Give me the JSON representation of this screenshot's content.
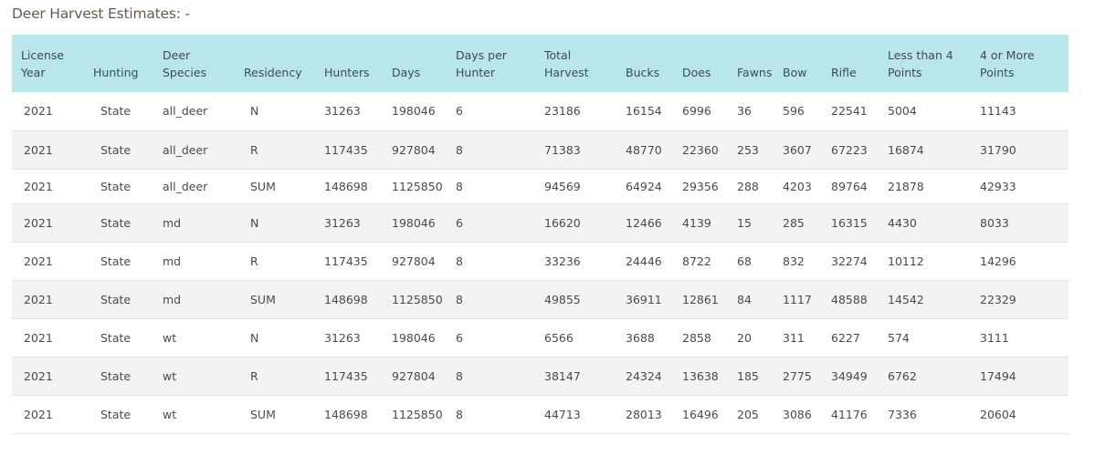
{
  "page": {
    "title": "Deer Harvest Estimates: -"
  },
  "table": {
    "columns": [
      {
        "key": "year",
        "label_lines": [
          "License",
          "Year"
        ]
      },
      {
        "key": "hunting",
        "label_lines": [
          "",
          "Hunting"
        ]
      },
      {
        "key": "species",
        "label_lines": [
          "Deer",
          "Species"
        ]
      },
      {
        "key": "residency",
        "label_lines": [
          "",
          "Residency"
        ]
      },
      {
        "key": "hunters",
        "label_lines": [
          "",
          "Hunters"
        ]
      },
      {
        "key": "days",
        "label_lines": [
          "",
          "Days"
        ]
      },
      {
        "key": "days_per_hunter",
        "label_lines": [
          "Days per",
          "Hunter"
        ]
      },
      {
        "key": "total_harvest",
        "label_lines": [
          "Total",
          "Harvest"
        ]
      },
      {
        "key": "bucks",
        "label_lines": [
          "",
          "Bucks"
        ]
      },
      {
        "key": "does",
        "label_lines": [
          "",
          "Does"
        ]
      },
      {
        "key": "fawns",
        "label_lines": [
          "",
          "Fawns"
        ]
      },
      {
        "key": "bow",
        "label_lines": [
          "",
          "Bow"
        ]
      },
      {
        "key": "rifle",
        "label_lines": [
          "",
          "Rifle"
        ]
      },
      {
        "key": "less_than_4",
        "label_lines": [
          "Less than 4",
          "Points"
        ]
      },
      {
        "key": "four_or_more",
        "label_lines": [
          "4 or More",
          "Points"
        ]
      }
    ],
    "rows": [
      [
        "2021",
        "State",
        "all_deer",
        "N",
        "31263",
        "198046",
        "6",
        "23186",
        "16154",
        "6996",
        "36",
        "596",
        "22541",
        "5004",
        "11143"
      ],
      [
        "2021",
        "State",
        "all_deer",
        "R",
        "117435",
        "927804",
        "8",
        "71383",
        "48770",
        "22360",
        "253",
        "3607",
        "67223",
        "16874",
        "31790"
      ],
      [
        "2021",
        "State",
        "all_deer",
        "SUM",
        "148698",
        "1125850",
        "8",
        "94569",
        "64924",
        "29356",
        "288",
        "4203",
        "89764",
        "21878",
        "42933"
      ],
      [
        "2021",
        "State",
        "md",
        "N",
        "31263",
        "198046",
        "6",
        "16620",
        "12466",
        "4139",
        "15",
        "285",
        "16315",
        "4430",
        "8033"
      ],
      [
        "2021",
        "State",
        "md",
        "R",
        "117435",
        "927804",
        "8",
        "33236",
        "24446",
        "8722",
        "68",
        "832",
        "32274",
        "10112",
        "14296"
      ],
      [
        "2021",
        "State",
        "md",
        "SUM",
        "148698",
        "1125850",
        "8",
        "49855",
        "36911",
        "12861",
        "84",
        "1117",
        "48588",
        "14542",
        "22329"
      ],
      [
        "2021",
        "State",
        "wt",
        "N",
        "31263",
        "198046",
        "6",
        "6566",
        "3688",
        "2858",
        "20",
        "311",
        "6227",
        "574",
        "3111"
      ],
      [
        "2021",
        "State",
        "wt",
        "R",
        "117435",
        "927804",
        "8",
        "38147",
        "24324",
        "13638",
        "185",
        "2775",
        "34949",
        "6762",
        "17494"
      ],
      [
        "2021",
        "State",
        "wt",
        "SUM",
        "148698",
        "1125850",
        "8",
        "44713",
        "28013",
        "16496",
        "205",
        "3086",
        "41176",
        "7336",
        "20604"
      ]
    ]
  },
  "colors": {
    "header_bg": "#b9e6ea",
    "row_alt_bg": "#f3f3f3",
    "title_color": "#6a5a4a"
  }
}
